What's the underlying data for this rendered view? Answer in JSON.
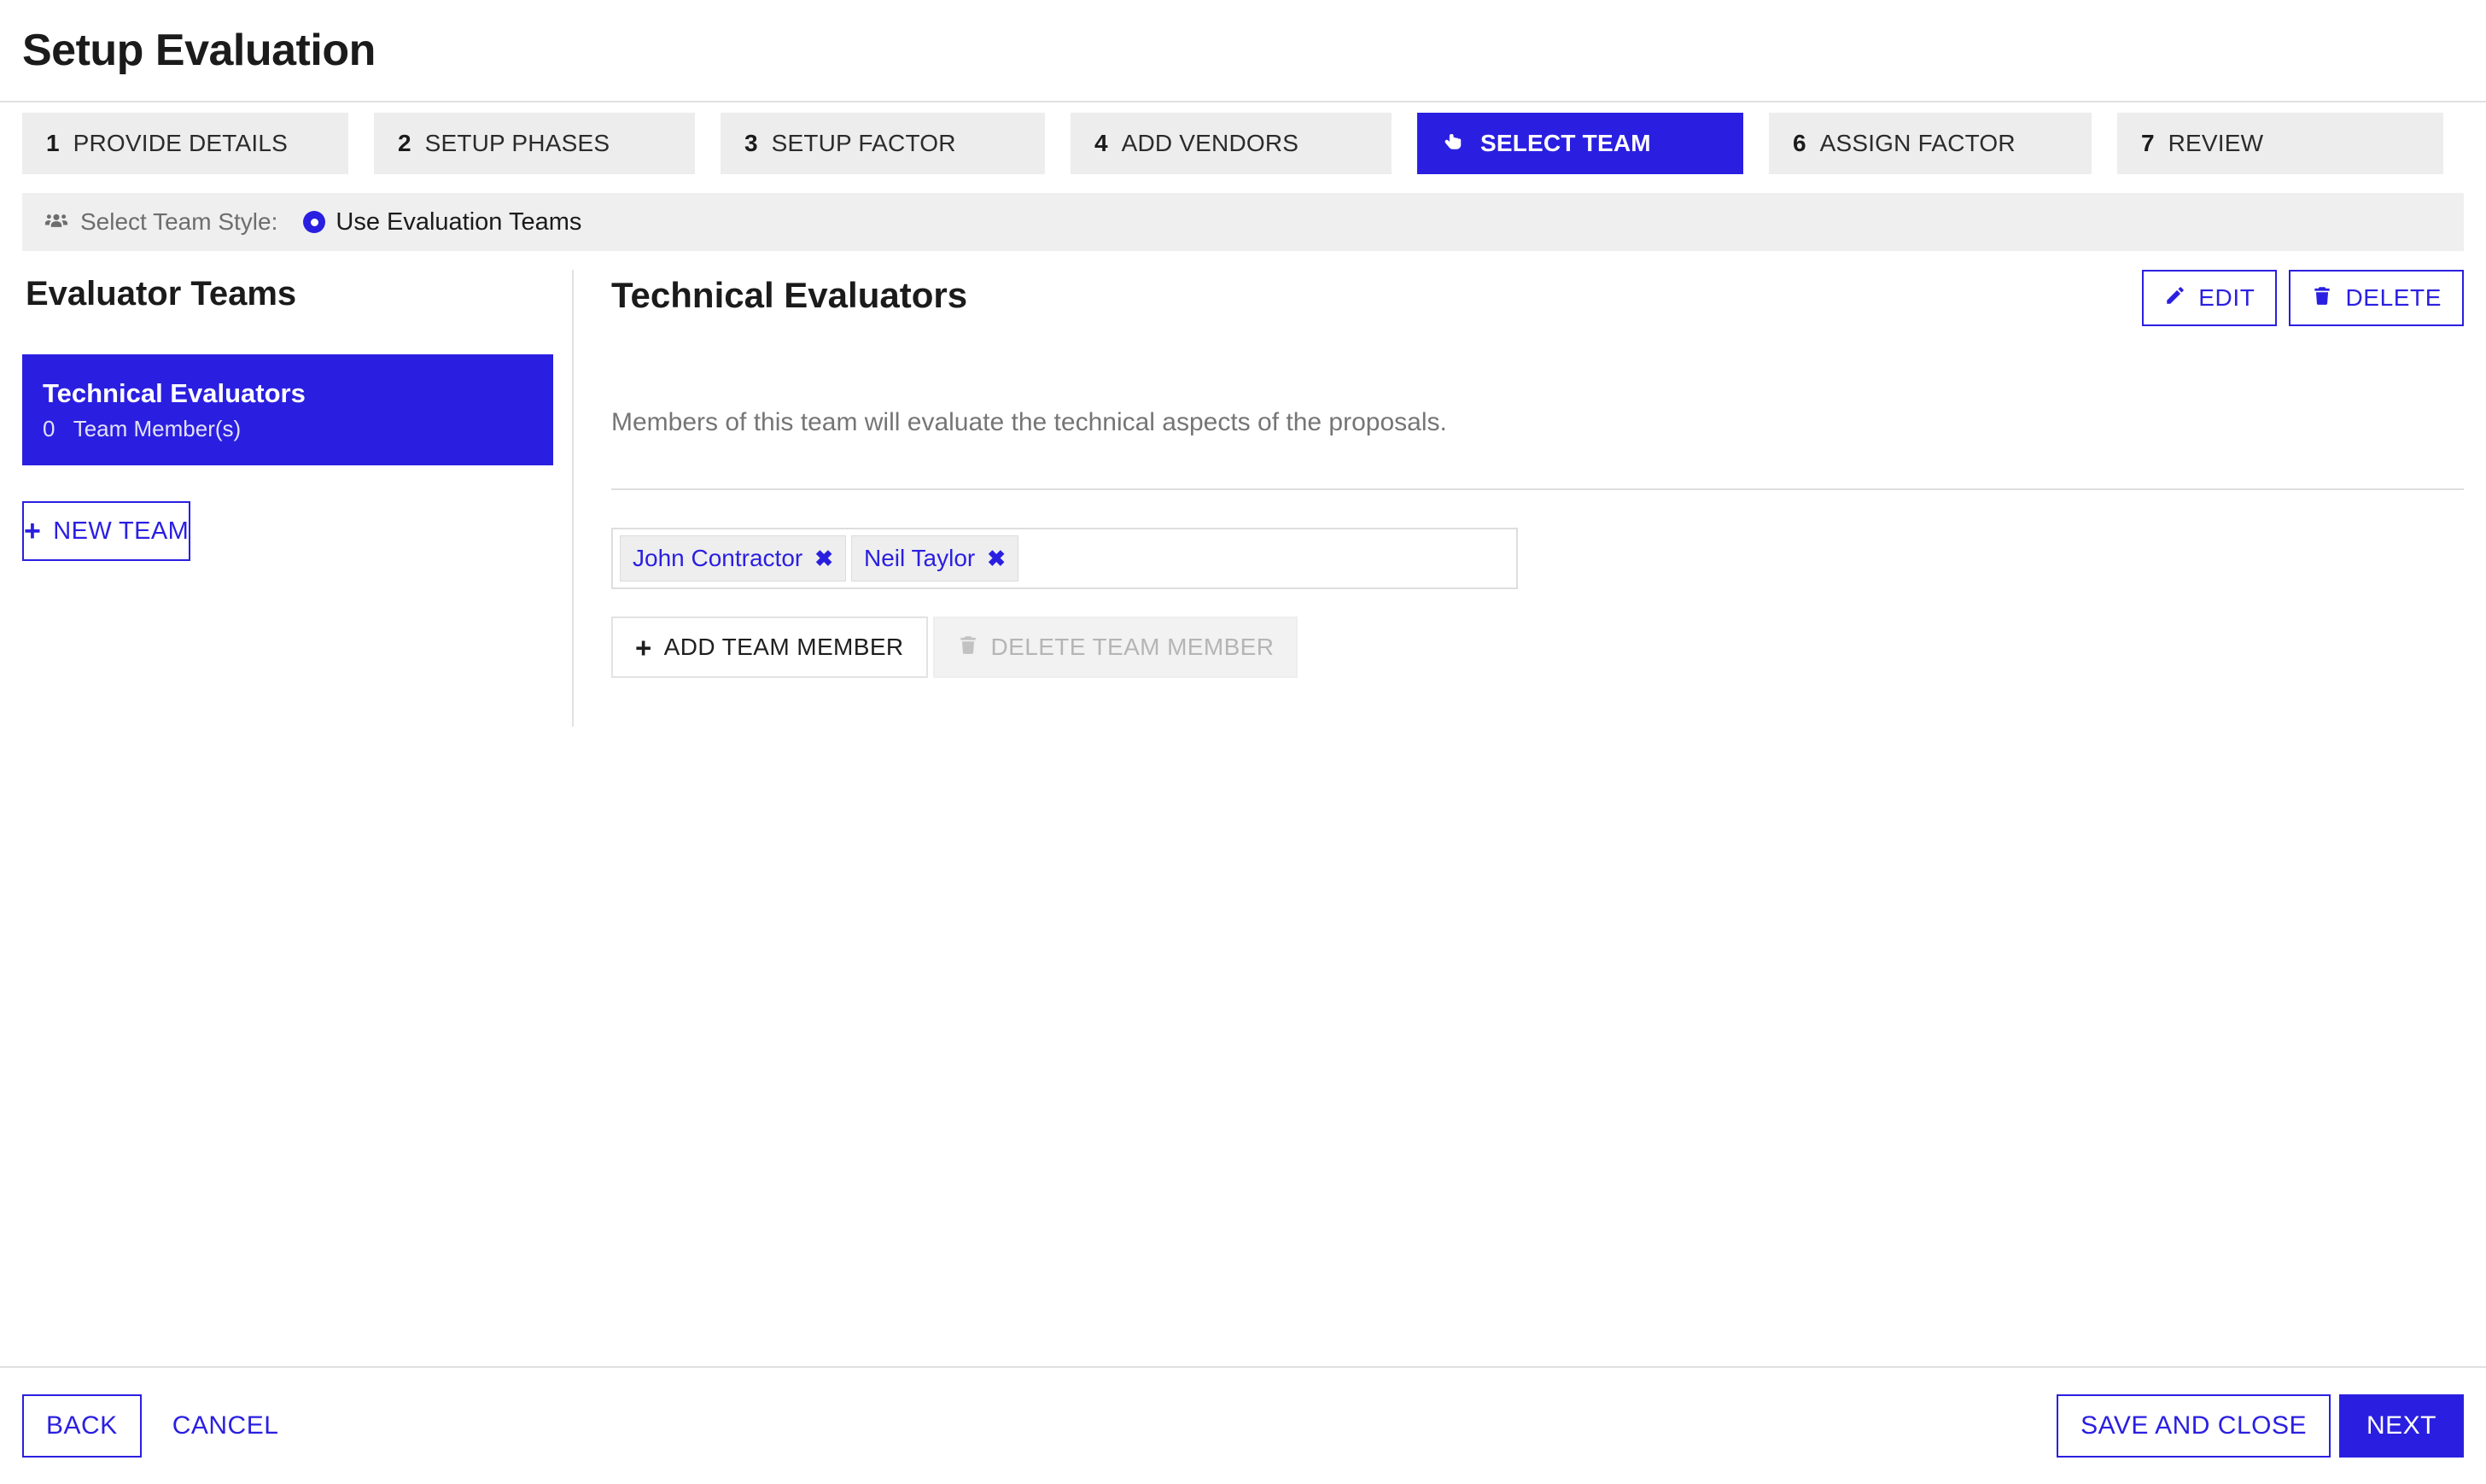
{
  "header": {
    "title": "Setup Evaluation"
  },
  "stepper": {
    "steps": [
      {
        "num": "1",
        "label": "PROVIDE DETAILS",
        "active": false,
        "icon": ""
      },
      {
        "num": "2",
        "label": "SETUP PHASES",
        "active": false,
        "icon": ""
      },
      {
        "num": "3",
        "label": "SETUP FACTOR",
        "active": false,
        "icon": ""
      },
      {
        "num": "4",
        "label": "ADD VENDORS",
        "active": false,
        "icon": ""
      },
      {
        "num": "",
        "label": "SELECT TEAM",
        "active": true,
        "icon": "pointing-hand-icon"
      },
      {
        "num": "6",
        "label": "ASSIGN FACTOR",
        "active": false,
        "icon": ""
      },
      {
        "num": "7",
        "label": "REVIEW",
        "active": false,
        "icon": ""
      }
    ]
  },
  "team_style": {
    "icon": "user-group-icon",
    "label": "Select Team Style:",
    "option_label": "Use Evaluation Teams",
    "selected": true
  },
  "sidebar": {
    "title": "Evaluator Teams",
    "teams": [
      {
        "name": "Technical Evaluators",
        "member_count": "0",
        "member_count_label": "Team Member(s)",
        "selected": true
      }
    ],
    "new_team_label": "NEW TEAM",
    "new_team_icon": "plus-icon"
  },
  "panel": {
    "title": "Technical Evaluators",
    "edit_label": "EDIT",
    "edit_icon": "pencil-icon",
    "delete_label": "DELETE",
    "delete_icon": "trash-icon",
    "description": "Members of this team will evaluate the technical aspects of the proposals.",
    "members": [
      {
        "name": "John Contractor",
        "remove_icon": "close-x-icon"
      },
      {
        "name": "Neil Taylor",
        "remove_icon": "close-x-icon"
      }
    ],
    "add_member_label": "ADD TEAM MEMBER",
    "add_member_icon": "plus-icon",
    "delete_member_label": "DELETE TEAM MEMBER",
    "delete_member_icon": "trash-icon",
    "delete_member_disabled": true
  },
  "footer": {
    "back_label": "BACK",
    "cancel_label": "CANCEL",
    "save_and_close_label": "SAVE AND CLOSE",
    "next_label": "NEXT"
  },
  "colors": {
    "accent": "#2A1FE0",
    "step_inactive_bg": "#ededed",
    "bar_bg": "#efefef",
    "muted_text": "#757575",
    "disabled_text": "#b5b5b5"
  }
}
